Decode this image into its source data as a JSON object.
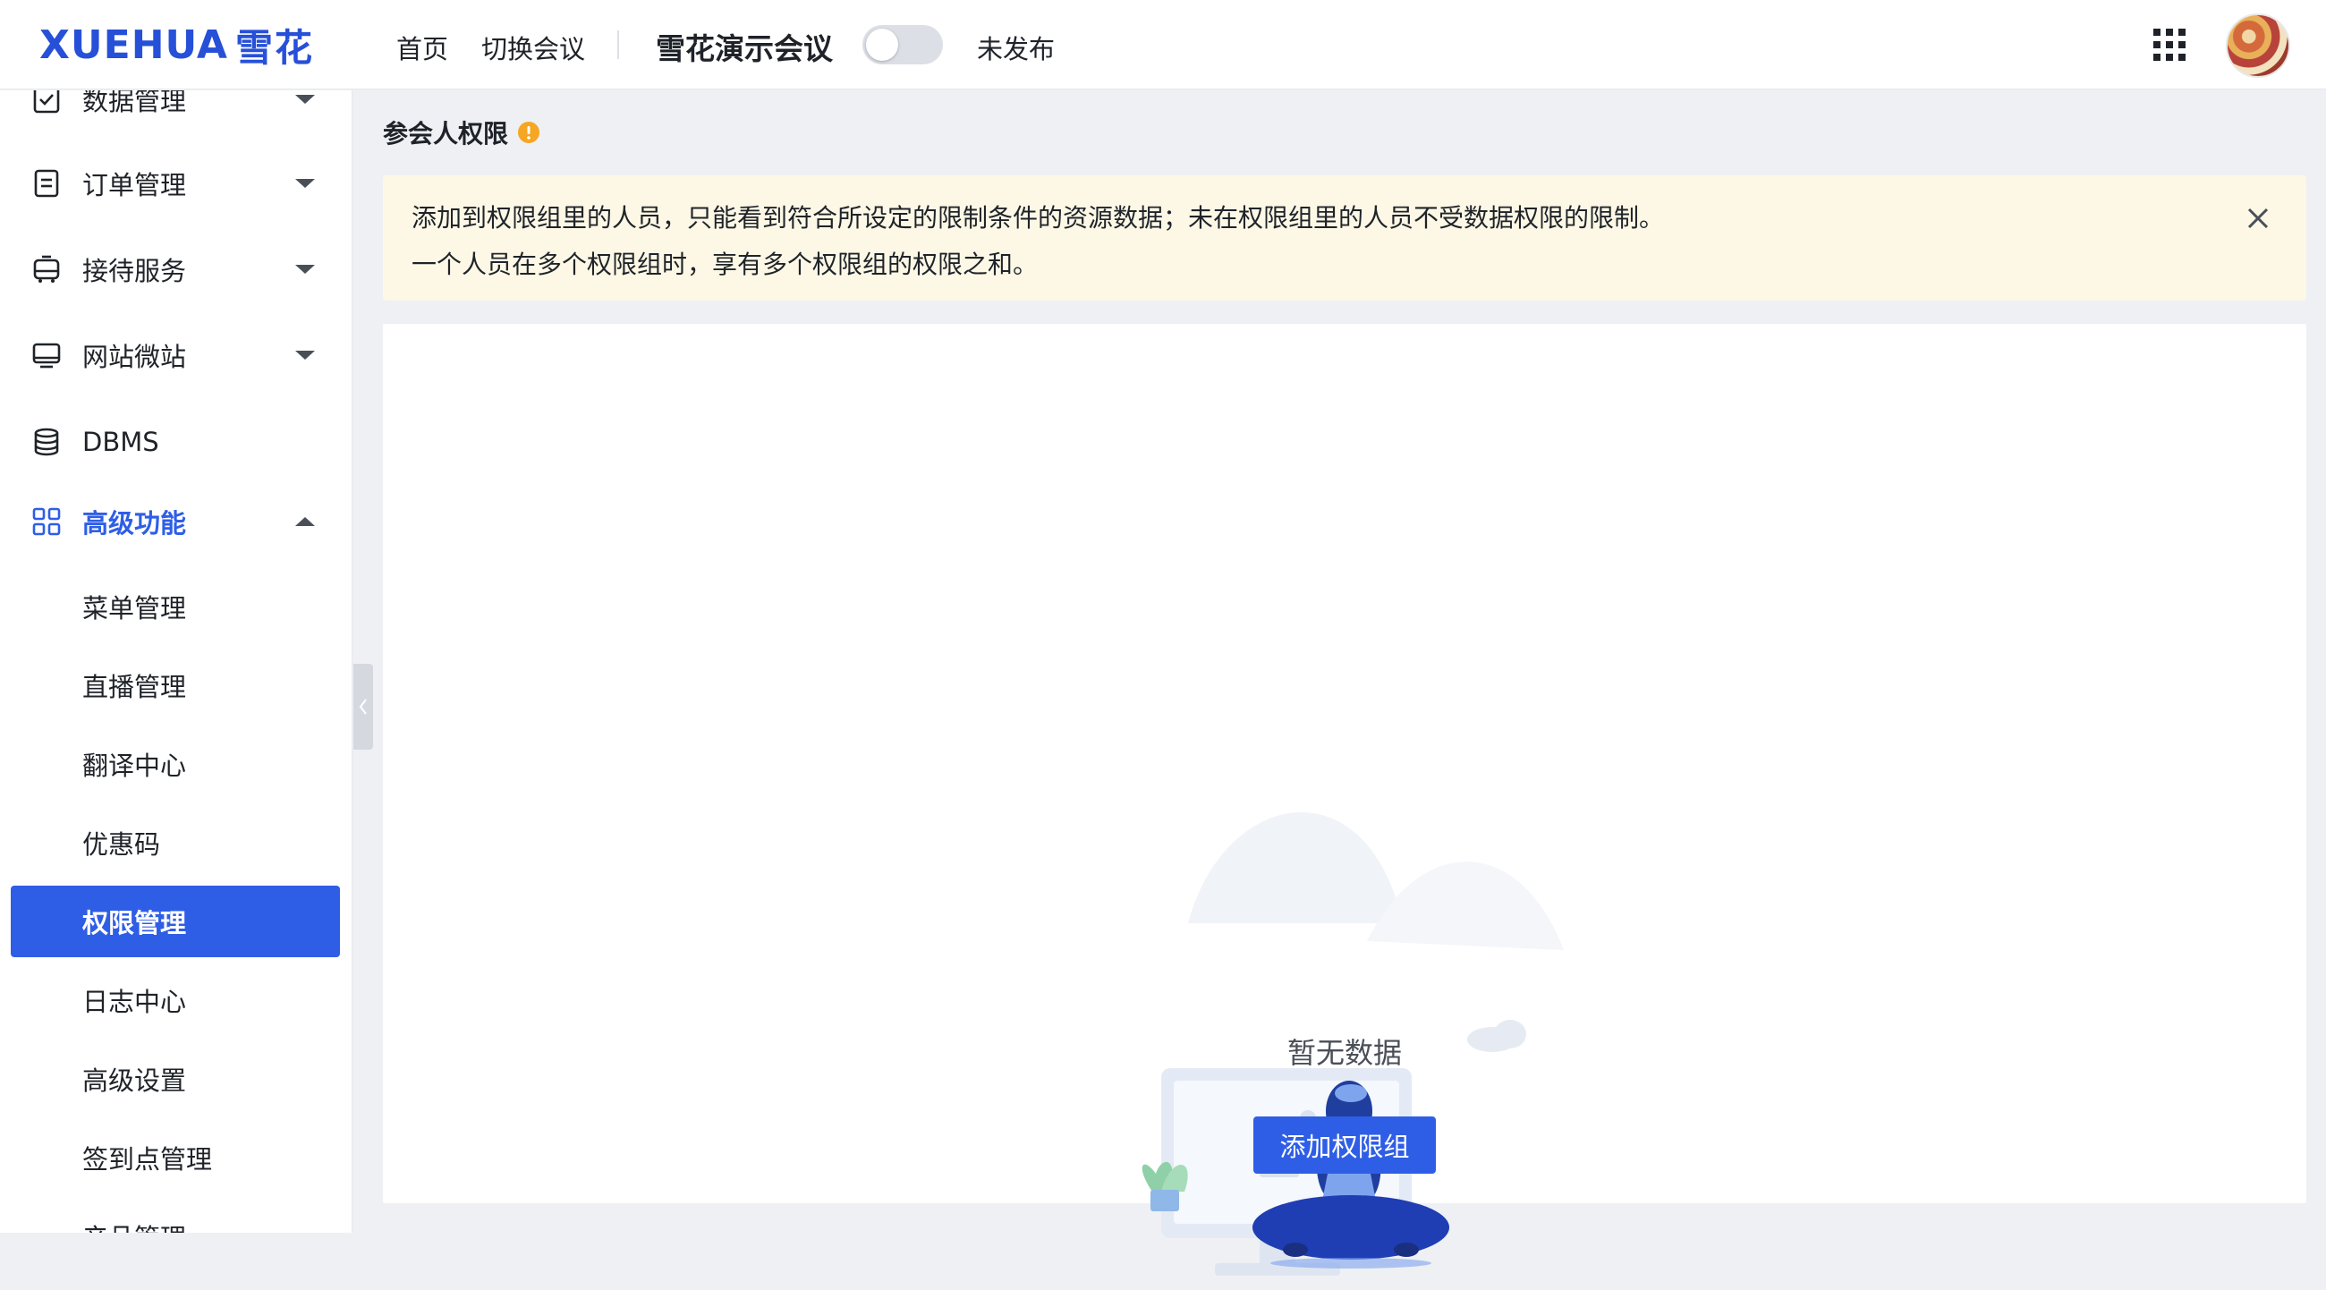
{
  "header": {
    "logo_latin": "XUEHUA",
    "logo_cn": "雪花",
    "nav": {
      "home": "首页",
      "switch": "切换会议"
    },
    "conference_title": "雪花演示会议",
    "publish_status": "未发布",
    "toggle_on": false,
    "icons": {
      "apps": "grid-apps-icon",
      "avatar": "user-avatar"
    }
  },
  "sidebar": {
    "items": [
      {
        "label": "数据管理",
        "icon": "checklist-icon",
        "expanded": false
      },
      {
        "label": "订单管理",
        "icon": "document-icon",
        "expanded": false
      },
      {
        "label": "接待服务",
        "icon": "bus-icon",
        "expanded": false
      },
      {
        "label": "网站微站",
        "icon": "monitor-icon",
        "expanded": false
      },
      {
        "label": "DBMS",
        "icon": "database-icon"
      },
      {
        "label": "高级功能",
        "icon": "apps-icon",
        "expanded": true,
        "children": [
          {
            "label": "菜单管理"
          },
          {
            "label": "直播管理"
          },
          {
            "label": "翻译中心"
          },
          {
            "label": "优惠码"
          },
          {
            "label": "权限管理",
            "selected": true
          },
          {
            "label": "日志中心"
          },
          {
            "label": "高级设置"
          },
          {
            "label": "签到点管理"
          },
          {
            "label": "产品管理"
          }
        ]
      }
    ]
  },
  "main": {
    "page_title": "参会人权限",
    "notice": {
      "line1": "添加到权限组里的人员，只能看到符合所设定的限制条件的资源数据；未在权限组里的人员不受数据权限的限制。",
      "line2": "一个人员在多个权限组时，享有多个权限组的权限之和。"
    },
    "empty_text": "暂无数据",
    "add_button": "添加权限组"
  },
  "colors": {
    "primary": "#2f5ee6",
    "notice_bg": "#fdf8e6",
    "warning": "#f5a623",
    "page_bg": "#eef0f4"
  }
}
